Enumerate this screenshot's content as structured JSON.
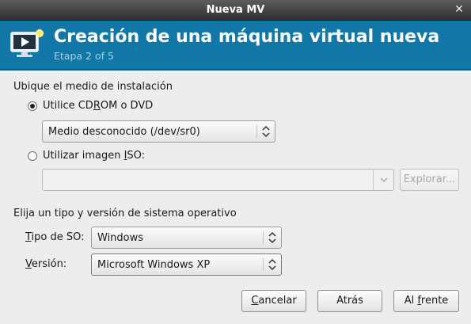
{
  "window": {
    "title": "Nueva MV",
    "close_glyph": "✕"
  },
  "banner": {
    "heading": "Creación de una máquina virtual nueva",
    "step": "Etapa 2 of 5",
    "icon": "virtual-machine-icon",
    "background": "#1077a7"
  },
  "install_media": {
    "section_label": "Ubique el medio de instalación",
    "cdrom_option": {
      "before": "Utilice CD",
      "mnemonic": "R",
      "after": "OM o DVD",
      "selected": true
    },
    "cdrom_device": "Medio desconocido (/dev/sr0)",
    "iso_option": {
      "before": "Utilizar imagen ",
      "mnemonic": "I",
      "after": "SO:",
      "selected": false
    },
    "iso_path": "",
    "browse_button": "Explorar..."
  },
  "os": {
    "section_label": "Elija un tipo y versión de sistema operativo",
    "type_label": {
      "mnemonic": "T",
      "rest": "ipo de SO:"
    },
    "type_value": "Windows",
    "version_label": {
      "mnemonic": "V",
      "rest": "ersión:"
    },
    "version_value": "Microsoft Windows XP"
  },
  "buttons": {
    "cancel": {
      "mnemonic": "C",
      "rest": "ancelar"
    },
    "back": "Atrás",
    "forward": {
      "before": "Al ",
      "mnemonic": "f",
      "after": "rente"
    }
  }
}
